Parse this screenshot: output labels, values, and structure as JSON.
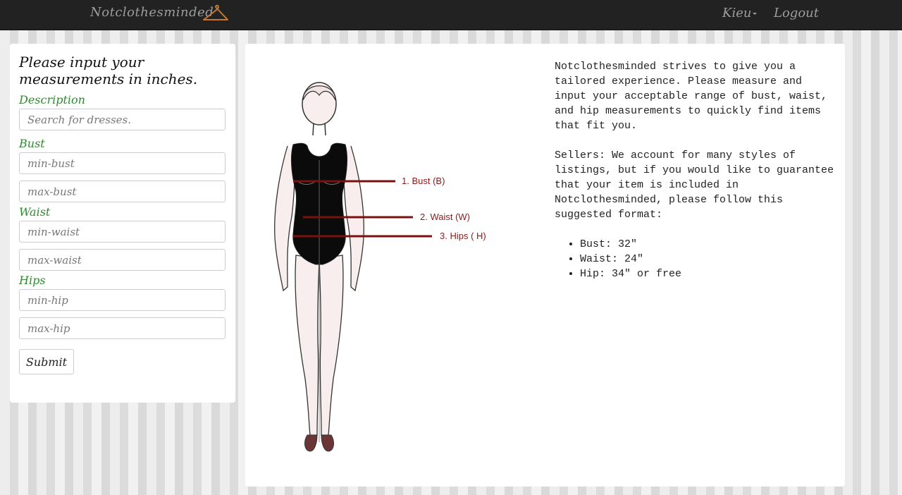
{
  "navbar": {
    "brand": "Notclothesminded",
    "user": "Kieu",
    "logout": "Logout"
  },
  "form": {
    "title": "Please input your measurements in inches.",
    "description_label": "Description",
    "description_placeholder": "Search for dresses.",
    "bust_label": "Bust",
    "min_bust_placeholder": "min-bust",
    "max_bust_placeholder": "max-bust",
    "waist_label": "Waist",
    "min_waist_placeholder": "min-waist",
    "max_waist_placeholder": "max-waist",
    "hips_label": "Hips",
    "min_hip_placeholder": "min-hip",
    "max_hip_placeholder": "max-hip",
    "submit_label": "Submit"
  },
  "figure": {
    "bust_label": "1. Bust (B)",
    "waist_label": "2. Waist (W)",
    "hips_label": "3. Hips ( H)",
    "line_color": "#7a1010"
  },
  "info": {
    "intro": "Notclothesminded strives to give you a tailored experience. Please measure and input your acceptable range of bust, waist, and hip measurements to quickly find items that fit you.",
    "sellers": "Sellers: We account for many styles of listings, but if you would like to guarantee that your item is included in Notclothesminded, please follow this suggested format:",
    "format": [
      "Bust: 32\"",
      "Waist: 24\"",
      "Hip: 34\" or free"
    ]
  }
}
